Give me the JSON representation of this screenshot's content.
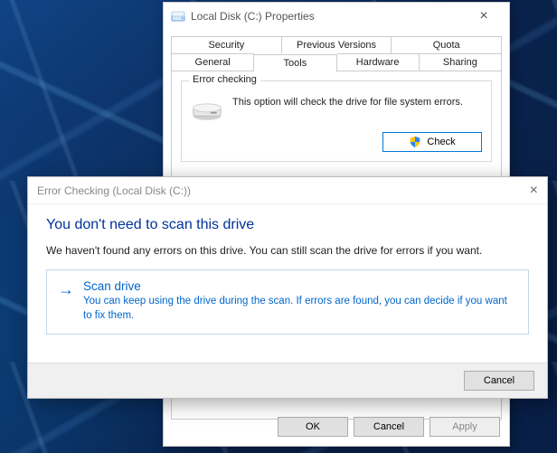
{
  "properties": {
    "title": "Local Disk (C:) Properties",
    "tabs_row1": [
      "Security",
      "Previous Versions",
      "Quota"
    ],
    "tabs_row2": [
      "General",
      "Tools",
      "Hardware",
      "Sharing"
    ],
    "active_tab": "Tools",
    "error_checking": {
      "legend": "Error checking",
      "text": "This option will check the drive for file system errors.",
      "button": "Check"
    },
    "buttons": {
      "ok": "OK",
      "cancel": "Cancel",
      "apply": "Apply"
    }
  },
  "dialog": {
    "title": "Error Checking (Local Disk (C:))",
    "heading": "You don't need to scan this drive",
    "message": "We haven't found any errors on this drive. You can still scan the drive for errors if you want.",
    "option": {
      "title": "Scan drive",
      "desc": "You can keep using the drive during the scan. If errors are found, you can decide if you want to fix them."
    },
    "cancel": "Cancel"
  }
}
